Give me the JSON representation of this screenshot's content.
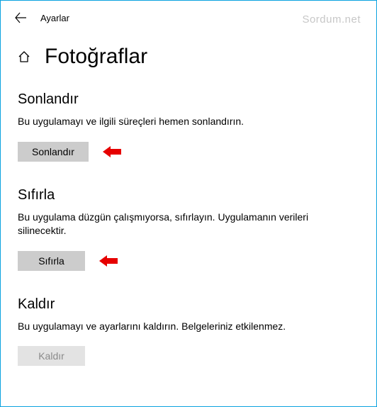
{
  "watermark": "Sordum.net",
  "header": {
    "title": "Ayarlar"
  },
  "page": {
    "title": "Fotoğraflar"
  },
  "sections": {
    "terminate": {
      "header": "Sonlandır",
      "description": "Bu uygulamayı ve ilgili süreçleri hemen sonlandırın.",
      "button_label": "Sonlandır"
    },
    "reset": {
      "header": "Sıfırla",
      "description": "Bu uygulama düzgün çalışmıyorsa, sıfırlayın. Uygulamanın verileri silinecektir.",
      "button_label": "Sıfırla"
    },
    "uninstall": {
      "header": "Kaldır",
      "description": "Bu uygulamayı ve ayarlarını kaldırın. Belgeleriniz etkilenmez.",
      "button_label": "Kaldır"
    }
  }
}
